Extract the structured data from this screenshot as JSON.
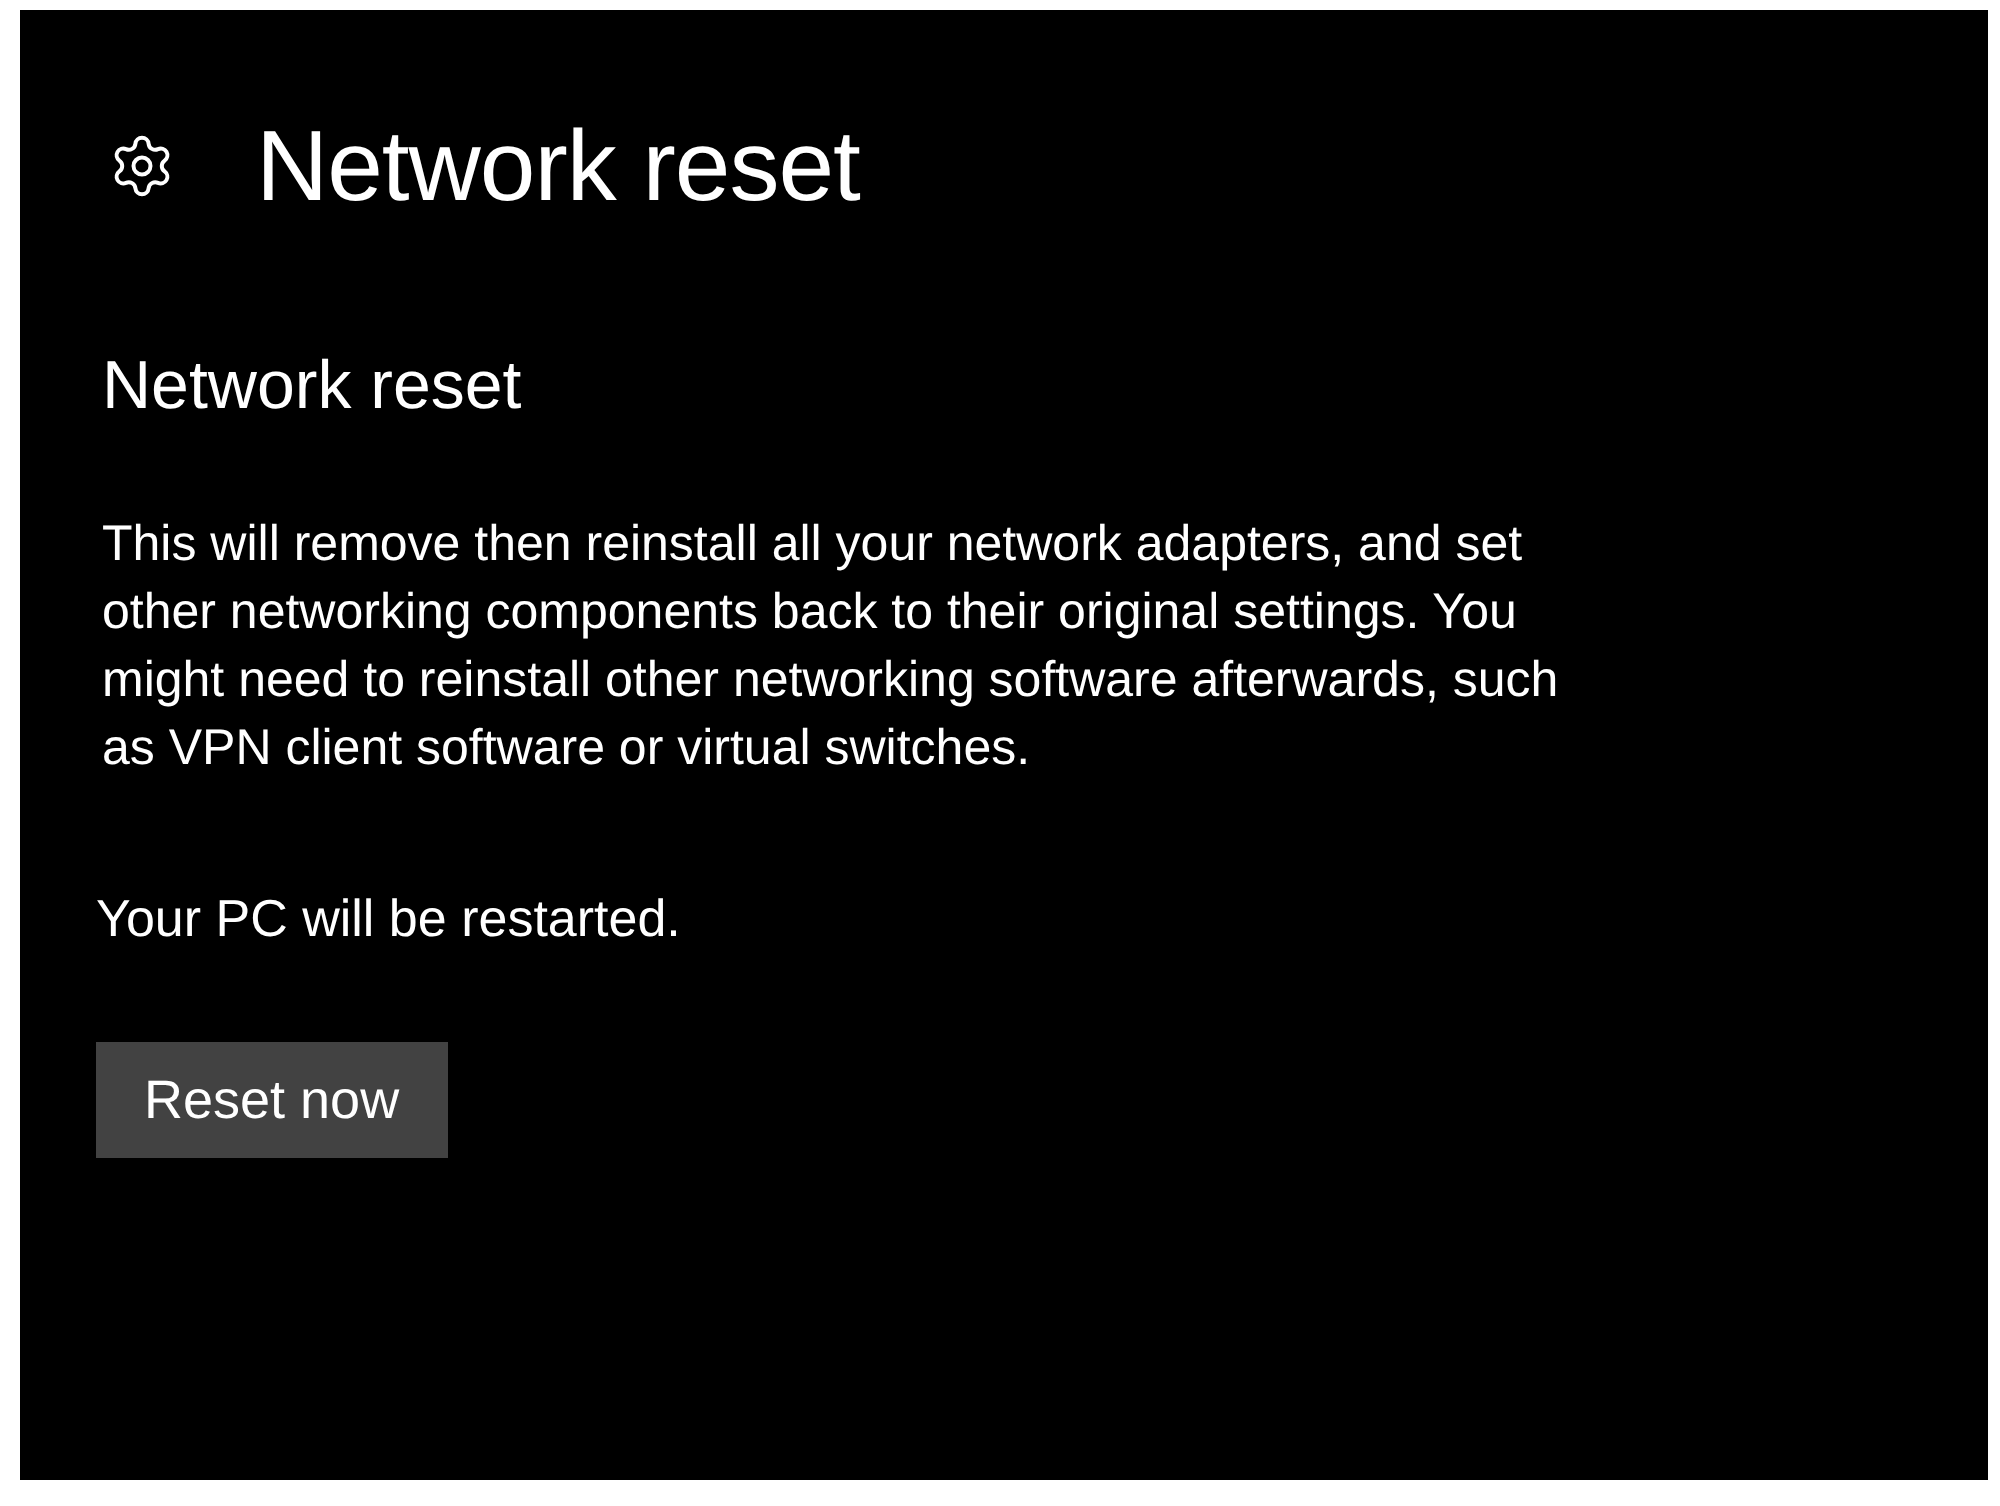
{
  "header": {
    "title": "Network reset"
  },
  "section": {
    "heading": "Network reset",
    "description_lines": [
      "This will remove then reinstall all your network adapters, and set",
      "other networking components back to their original settings. You",
      "might need to reinstall other networking software afterwards, such",
      "as VPN client software or virtual switches."
    ],
    "note": "Your PC will be restarted."
  },
  "button": {
    "label": "Reset now"
  }
}
